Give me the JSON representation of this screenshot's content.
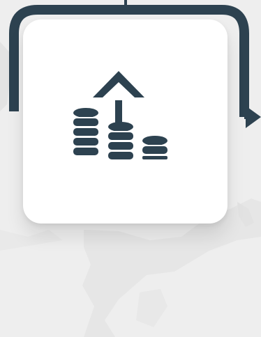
{
  "scene": {
    "accent_color": "#2d4250",
    "card_color": "#ffffff",
    "background_color": "#eeeeee",
    "icon": "coins-growth-arrow-icon"
  }
}
